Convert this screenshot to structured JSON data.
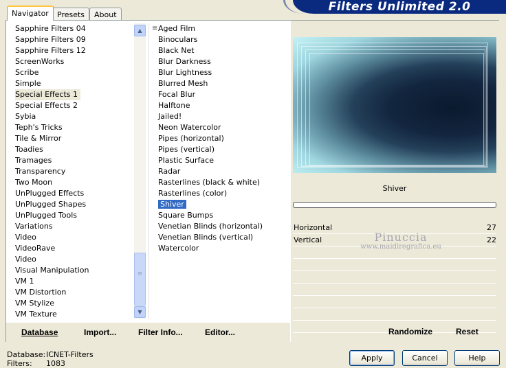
{
  "window": {
    "title": "Filters Unlimited 2.0"
  },
  "tabs": [
    {
      "label": "Navigator",
      "active": true
    },
    {
      "label": "Presets",
      "active": false
    },
    {
      "label": "About",
      "active": false
    }
  ],
  "categories": [
    "Sapphire Filters 04",
    "Sapphire Filters 09",
    "Sapphire Filters 12",
    "ScreenWorks",
    "Scribe",
    "Simple",
    "Special Effects 1",
    "Special Effects 2",
    "Sybia",
    "Teph's Tricks",
    "Tile & Mirror",
    "Toadies",
    "Tramages",
    "Transparency",
    "Two Moon",
    "UnPlugged Effects",
    "UnPlugged Shapes",
    "UnPlugged Tools",
    "Variations",
    "Video",
    "VideoRave",
    "Video",
    "Visual Manipulation",
    "VM 1",
    "VM Distortion",
    "VM Stylize",
    "VM Texture"
  ],
  "selected_category": "Special Effects 1",
  "filters": [
    "Aged Film",
    "Binoculars",
    "Black Net",
    "Blur Darkness",
    "Blur Lightness",
    "Blurred Mesh",
    "Focal Blur",
    "Halftone",
    "Jailed!",
    "Neon Watercolor",
    "Pipes (horizontal)",
    "Pipes (vertical)",
    "Plastic Surface",
    "Radar",
    "Rasterlines (black & white)",
    "Rasterlines (color)",
    "Shiver",
    "Square Bumps",
    "Venetian Blinds (horizontal)",
    "Venetian Blinds (vertical)",
    "Watercolor"
  ],
  "selected_filter": "Shiver",
  "preview": {
    "filter_name": "Shiver"
  },
  "params": [
    {
      "label": "Horizontal",
      "value": "27"
    },
    {
      "label": "Vertical",
      "value": "22"
    }
  ],
  "watermark": {
    "line1": "Pinuccia",
    "line2": "www.maidiregrafica.eu"
  },
  "toolbar": {
    "database": "Database",
    "import": "Import...",
    "filter_info": "Filter Info...",
    "editor": "Editor...",
    "randomize": "Randomize",
    "reset": "Reset"
  },
  "status": {
    "database_label": "Database:",
    "database_value": "ICNET-Filters",
    "filters_label": "Filters:",
    "filters_value": "1083"
  },
  "buttons": {
    "apply": "Apply",
    "cancel": "Cancel",
    "help": "Help"
  },
  "icons": {
    "scroll_up": "scroll-up-arrow-icon",
    "scroll_down": "scroll-down-arrow-icon",
    "scroll_grip": "scroll-grip-icon"
  }
}
